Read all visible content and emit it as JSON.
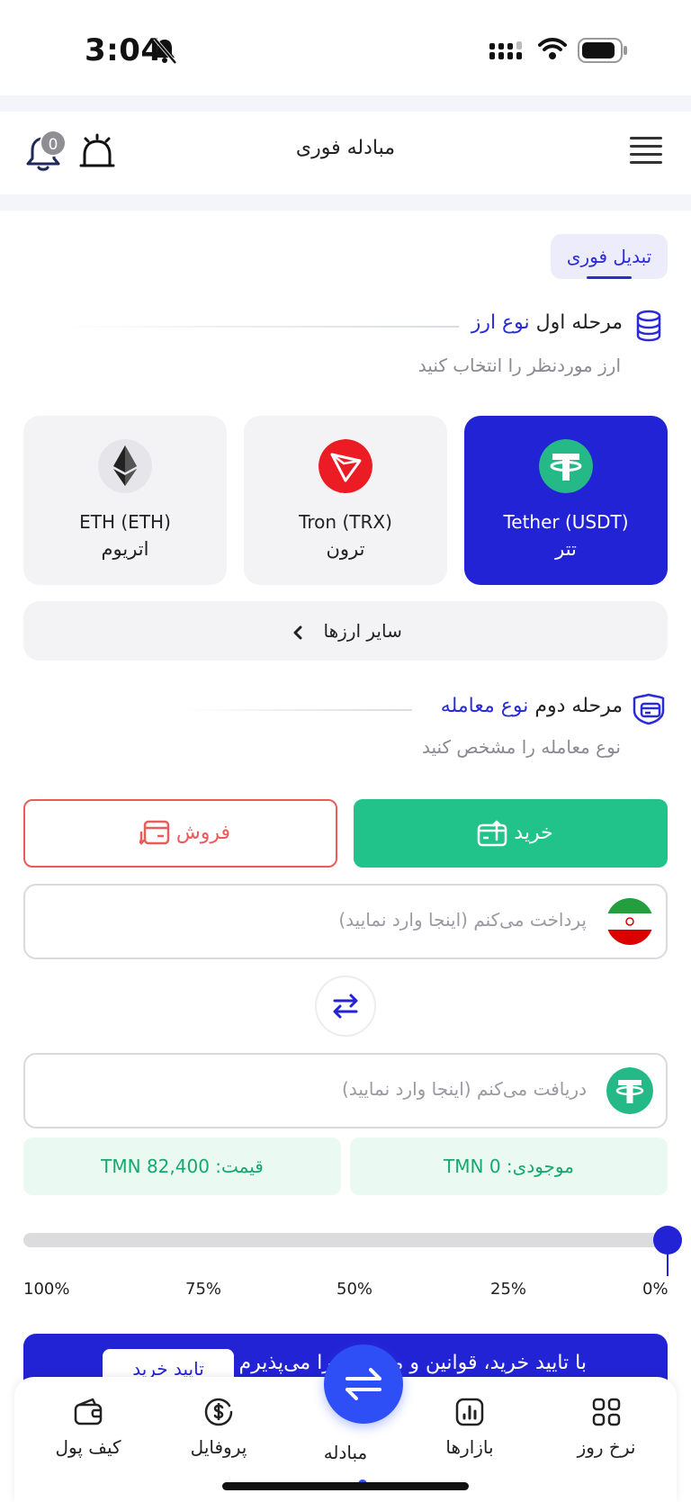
{
  "status_bar": {
    "time": "3:04"
  },
  "header": {
    "title": "مبادله فوری",
    "notification_count": "0"
  },
  "tab": {
    "label": "تبدیل فوری"
  },
  "step1": {
    "prefix": "مرحله اول",
    "accent": "نوع ارز",
    "hint": "ارز موردنظر را انتخاب کنید"
  },
  "coins": [
    {
      "en": "Tether (USDT)",
      "fa": "تتر",
      "selected": true,
      "color": "#26b988"
    },
    {
      "en": "Tron (TRX)",
      "fa": "ترون",
      "selected": false,
      "color": "#ec1c24"
    },
    {
      "en": "ETH (ETH)",
      "fa": "اتریوم",
      "selected": false,
      "color": "#e6e6ea"
    }
  ],
  "other_coins": {
    "label": "سایر ارزها"
  },
  "step2": {
    "prefix": "مرحله دوم",
    "accent": "نوع معامله",
    "hint": "نوع معامله را مشخص کنید"
  },
  "trade": {
    "buy_label": "خرید",
    "sell_label": "فروش"
  },
  "pay_field": {
    "placeholder": "پرداخت می‌کنم (اینجا وارد نمایید)"
  },
  "receive_field": {
    "placeholder": "دریافت می‌کنم (اینجا وارد نمایید)"
  },
  "balance": {
    "text": "موجودی: 0 TMN"
  },
  "price": {
    "text": "قیمت: 82,400 TMN"
  },
  "slider": {
    "value_percent": 0,
    "labels": [
      "100%",
      "75%",
      "50%",
      "25%",
      "0%"
    ]
  },
  "confirm": {
    "text": "با تایید خرید، قوانین و مقررات را می‌پذیرم",
    "button": "تایید خرید"
  },
  "nav": {
    "items": [
      {
        "label": "کیف پول",
        "icon": "wallet-icon"
      },
      {
        "label": "پروفایل",
        "icon": "dollar-circle-icon"
      },
      {
        "label": "مبادله",
        "icon": "exchange-icon"
      },
      {
        "label": "بازارها",
        "icon": "chart-icon"
      },
      {
        "label": "نرخ روز",
        "icon": "grid-icon"
      }
    ]
  },
  "colors": {
    "primary": "#2323d6",
    "success": "#22c38a",
    "danger": "#ea5b5b",
    "fab": "#2d4ff5"
  }
}
